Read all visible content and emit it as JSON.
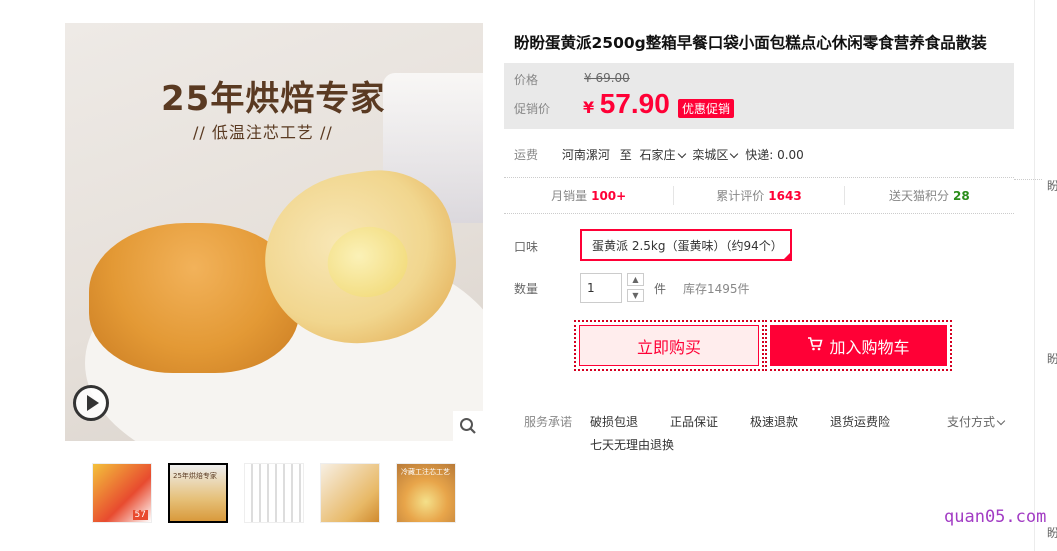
{
  "main_image": {
    "headline": "25年烘焙专家",
    "subline": "// 低温注芯工艺 //"
  },
  "thumbnails": [
    {
      "name": "thumbnail-1",
      "badge": "57"
    },
    {
      "name": "thumbnail-2",
      "caption": "25年烘焙专家"
    },
    {
      "name": "thumbnail-3"
    },
    {
      "name": "thumbnail-4"
    },
    {
      "name": "thumbnail-5",
      "caption": "冷藏工注芯工艺"
    }
  ],
  "product": {
    "title": "盼盼蛋黄派2500g整箱早餐口袋小面包糕点心休闲零食营养食品散装"
  },
  "price": {
    "orig_label": "价格",
    "orig_value": "¥ 69.00",
    "promo_label": "促销价",
    "currency": "¥",
    "promo_value": "57.90",
    "promo_tag": "优惠促销"
  },
  "shipping": {
    "label": "运费",
    "from": "河南漯河",
    "to_word": "至",
    "city": "石家庄",
    "district": "栾城区",
    "fee": "快递: 0.00"
  },
  "stats": {
    "monthly_sales_label": "月销量",
    "monthly_sales_value": "100+",
    "reviews_label": "累计评价",
    "reviews_value": "1643",
    "points_label": "送天猫积分",
    "points_value": "28"
  },
  "options": {
    "flavor_label": "口味",
    "flavor_value": "蛋黄派 2.5kg（蛋黄味）（约94个）",
    "qty_label": "数量",
    "qty_value": "1",
    "qty_unit": "件",
    "stock": "库存1495件"
  },
  "actions": {
    "buy_now": "立即购买",
    "add_to_cart": "加入购物车"
  },
  "services": {
    "label": "服务承诺",
    "items": [
      "破损包退",
      "正品保证",
      "极速退款",
      "退货运费险",
      "七天无理由退换"
    ],
    "payment": "支付方式"
  },
  "edge": {
    "text1": "盼",
    "text2": "盼",
    "text3": "盼"
  },
  "watermark": "quan05.com",
  "colors": {
    "accent": "#ff0036",
    "price_bg": "#e9e9e9",
    "points": "#2a8d1a"
  }
}
